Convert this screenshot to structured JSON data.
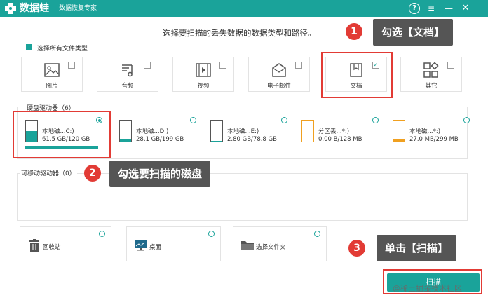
{
  "titlebar": {
    "brand": "数据蛙",
    "subtitle": "数据恢复专家",
    "help": "?",
    "menu": "≡",
    "minimize": "—",
    "close": "✕"
  },
  "heading": "选择要扫描的丢失数据的数据类型和路径。",
  "select_all": "选择所有文件类型",
  "file_types": [
    {
      "label": "图片",
      "icon": "image-icon",
      "checked": false
    },
    {
      "label": "音频",
      "icon": "music-icon",
      "checked": false
    },
    {
      "label": "视频",
      "icon": "video-icon",
      "checked": false
    },
    {
      "label": "电子邮件",
      "icon": "mail-icon",
      "checked": false
    },
    {
      "label": "文档",
      "icon": "document-icon",
      "checked": true,
      "check_mark": "✓"
    },
    {
      "label": "其它",
      "icon": "other-icon",
      "checked": false
    }
  ],
  "hard_drives": {
    "title": "硬盘驱动器（6）",
    "items": [
      {
        "name": "本地磁...C:)",
        "size": "61.5 GB/120 GB",
        "selected": true,
        "fill": 0.51,
        "style": "teal"
      },
      {
        "name": "本地磁...D:)",
        "size": "28.1 GB/199 GB",
        "selected": false,
        "fill": 0.14,
        "style": "teal"
      },
      {
        "name": "本地磁...E:)",
        "size": "2.80 GB/78.8 GB",
        "selected": false,
        "fill": 0.04,
        "style": "teal"
      },
      {
        "name": "分区丢...*:)",
        "size": "0.00  B/128 MB",
        "selected": false,
        "fill": 0.0,
        "style": "orange"
      },
      {
        "name": "本地磁...*:)",
        "size": "27.0 MB/299 MB",
        "selected": false,
        "fill": 0.09,
        "style": "orange"
      }
    ]
  },
  "removable": {
    "title": "可移动驱动器（0）"
  },
  "locations": [
    {
      "label": "回收站",
      "icon": "trash-icon"
    },
    {
      "label": "桌面",
      "icon": "desktop-icon"
    },
    {
      "label": "选择文件夹",
      "icon": "folder-icon"
    }
  ],
  "scan_label": "扫描",
  "callouts": [
    {
      "num": "1",
      "text": "勾选【文档】"
    },
    {
      "num": "2",
      "text": "勾选要扫描的磁盘"
    },
    {
      "num": "3",
      "text": "单击【扫描】"
    }
  ],
  "watermark": "@稀土掘金技术社区",
  "colors": {
    "accent": "#1aa39a",
    "highlight": "#e23b35",
    "callout_bg": "#555555",
    "orange": "#f0a020"
  }
}
